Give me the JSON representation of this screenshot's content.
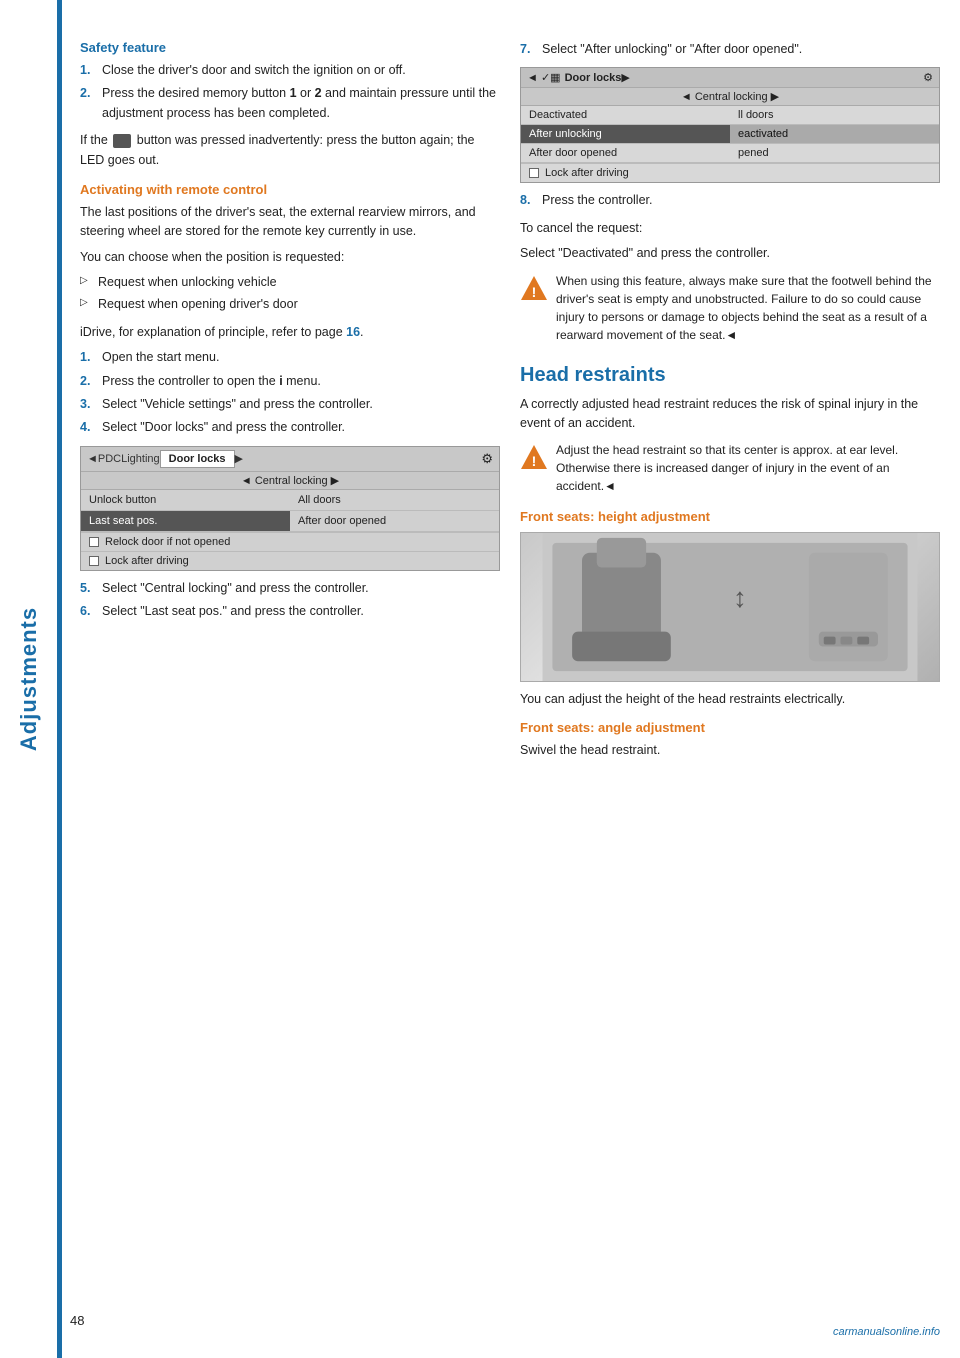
{
  "sidebar": {
    "label": "Adjustments"
  },
  "left_column": {
    "safety_feature": {
      "title": "Safety feature",
      "steps": [
        "Close the driver's door and switch the ignition on or off.",
        "Press the desired memory button 1 or 2 and maintain pressure until the adjustment process has been completed.",
        "If the  button was pressed inadvertently: press the button again; the LED goes out."
      ],
      "step2_bold": "1",
      "step2_bold2": "2",
      "inadvertent_note": "If the  button was pressed inadvertently: press the button again; the LED goes out."
    },
    "activating": {
      "title": "Activating with remote control",
      "intro": "The last positions of the driver's seat, the external rearview mirrors, and steering wheel are stored for the remote key currently in use.",
      "choose_text": "You can choose when the position is requested:",
      "bullets": [
        "Request when unlocking vehicle",
        "Request when opening driver's door"
      ],
      "idrive_ref": "iDrive, for explanation of principle, refer to page 16.",
      "page_ref": "16",
      "steps": [
        "Open the start menu.",
        "Press the controller to open the  menu.",
        "Select \"Vehicle settings\" and press the controller.",
        "Select \"Door locks\" and press the controller.",
        "Select \"Central locking\" and press the controller.",
        "Select \"Last seat pos.\" and press the controller."
      ]
    },
    "menu1": {
      "tabs": [
        "PDC",
        "Lighting",
        "Door locks"
      ],
      "active_tab": "Door locks",
      "center_row": "Central locking",
      "rows": [
        [
          "Unlock button",
          "All doors"
        ],
        [
          "Last seat pos.",
          "After door opened"
        ]
      ],
      "checkboxes": [
        "Relock door if not opened",
        "Lock after driving"
      ]
    },
    "page_number": "48"
  },
  "right_column": {
    "step7": "Select \"After unlocking\" or \"After door opened\".",
    "menu2": {
      "top_left": "Door locks",
      "center_row": "Central locking",
      "rows": [
        [
          "Deactivated",
          "ll doors"
        ],
        [
          "After unlocking",
          "eactivated"
        ],
        [
          "After door opened",
          "pened"
        ]
      ],
      "checkbox_row": "Lock after driving"
    },
    "step8": "Press the controller.",
    "cancel_note": "To cancel the request:",
    "cancel_instruction": "Select \"Deactivated\" and press the controller.",
    "warning1": "When using this feature, always make sure that the footwell behind the driver's seat is empty and unobstructed. Failure to do so could cause injury to persons or damage to objects behind the seat as a result of a rearward movement of the seat.◄",
    "head_restraints": {
      "title": "Head restraints",
      "intro": "A correctly adjusted head restraint reduces the risk of spinal injury in the event of an accident.",
      "warning": "Adjust the head restraint so that its center is approx. at ear level. Otherwise there is increased danger of injury in the event of an accident.◄",
      "front_height_title": "Front seats: height adjustment",
      "front_height_text": "You can adjust the height of the head restraints electrically.",
      "front_angle_title": "Front seats: angle adjustment",
      "front_angle_text": "Swivel the head restraint."
    }
  },
  "icons": {
    "warning_triangle": "⚠",
    "arrow_right": "▷",
    "arrow_left": "◁",
    "menu_icon": "≡",
    "back_arrow": "◄"
  }
}
